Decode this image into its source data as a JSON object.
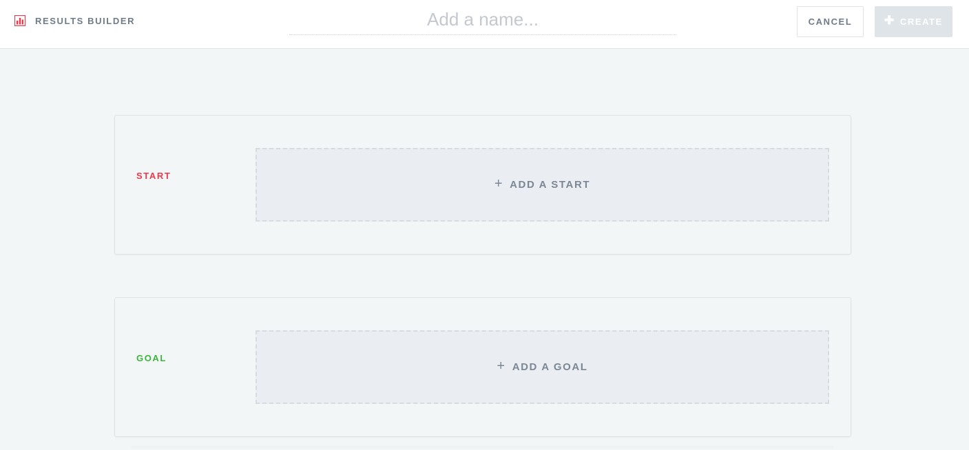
{
  "header": {
    "brand_label": "RESULTS BUILDER",
    "brand_icon": "bar-chart-icon",
    "brand_color": "#e83a48",
    "name_placeholder": "Add a name...",
    "name_value": "",
    "cancel_label": "CANCEL",
    "create_label": "CREATE",
    "create_icon": "plus-icon",
    "create_enabled": false
  },
  "sections": {
    "start": {
      "label": "START",
      "label_color": "#e83a48",
      "add_label": "ADD A START",
      "add_icon": "plus-icon"
    },
    "goal": {
      "label": "GOAL",
      "label_color": "#3bb53b",
      "add_label": "ADD A GOAL",
      "add_icon": "plus-icon"
    }
  }
}
